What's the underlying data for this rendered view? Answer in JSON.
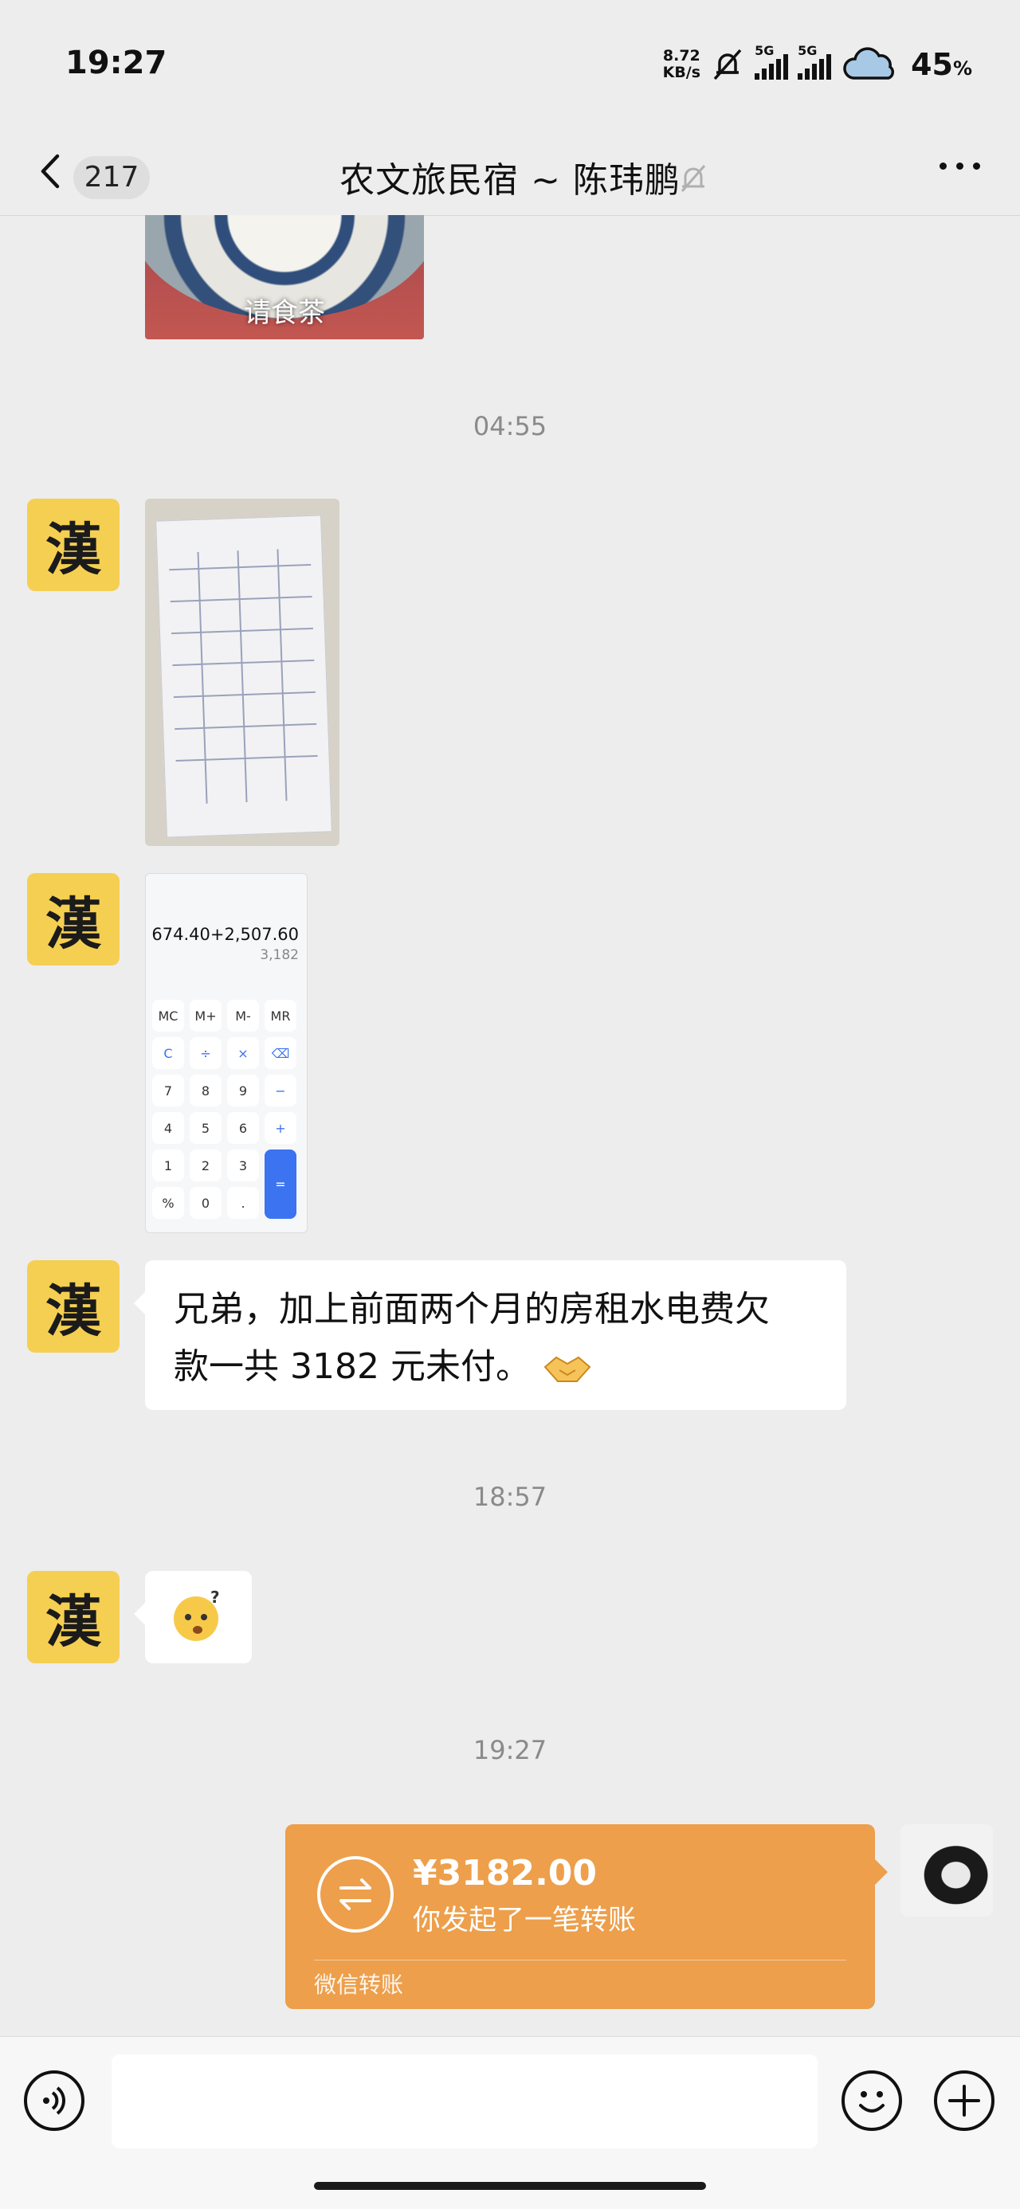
{
  "status_bar": {
    "time": "19:27",
    "net_speed_value": "8.72",
    "net_speed_unit": "KB/s",
    "sim1_label": "5G",
    "sim2_label": "5G",
    "battery": "45",
    "battery_unit": "%"
  },
  "header": {
    "back_count": "217",
    "title": "农文旅民宿 ~ 陈玮鹏"
  },
  "messages": {
    "image_caption": "请食茶",
    "time_1": "04:55",
    "avatar_char": "漢",
    "calc_expression": "674.40+2,507.60",
    "calc_result": "3,182",
    "calc_keys": [
      "MC",
      "M+",
      "M-",
      "MR",
      "C",
      "÷",
      "×",
      "⌫",
      "7",
      "8",
      "9",
      "−",
      "4",
      "5",
      "6",
      "+",
      "1",
      "2",
      "3",
      "=",
      "%",
      "0",
      "."
    ],
    "text_line1": "兄弟，加上前面两个月的房租水电费欠",
    "text_line2": "款一共 3182 元未付。",
    "time_2": "18:57",
    "time_3": "19:27"
  },
  "transfer": {
    "amount": "¥3182.00",
    "description": "你发起了一笔转账",
    "footer": "微信转账"
  },
  "colors": {
    "background": "#ededed",
    "transfer_orange": "#ed9f4b",
    "avatar_yellow": "#f5cf52",
    "calc_blue": "#3b73f0"
  },
  "icons": [
    "mute-bell-icon",
    "signal-icon",
    "weather-cloud-icon",
    "back-chevron-icon",
    "bell-off-icon",
    "more-icon",
    "handshake-icon",
    "confused-face-icon",
    "transfer-arrows-icon",
    "voice-icon",
    "emoji-icon",
    "plus-icon"
  ]
}
